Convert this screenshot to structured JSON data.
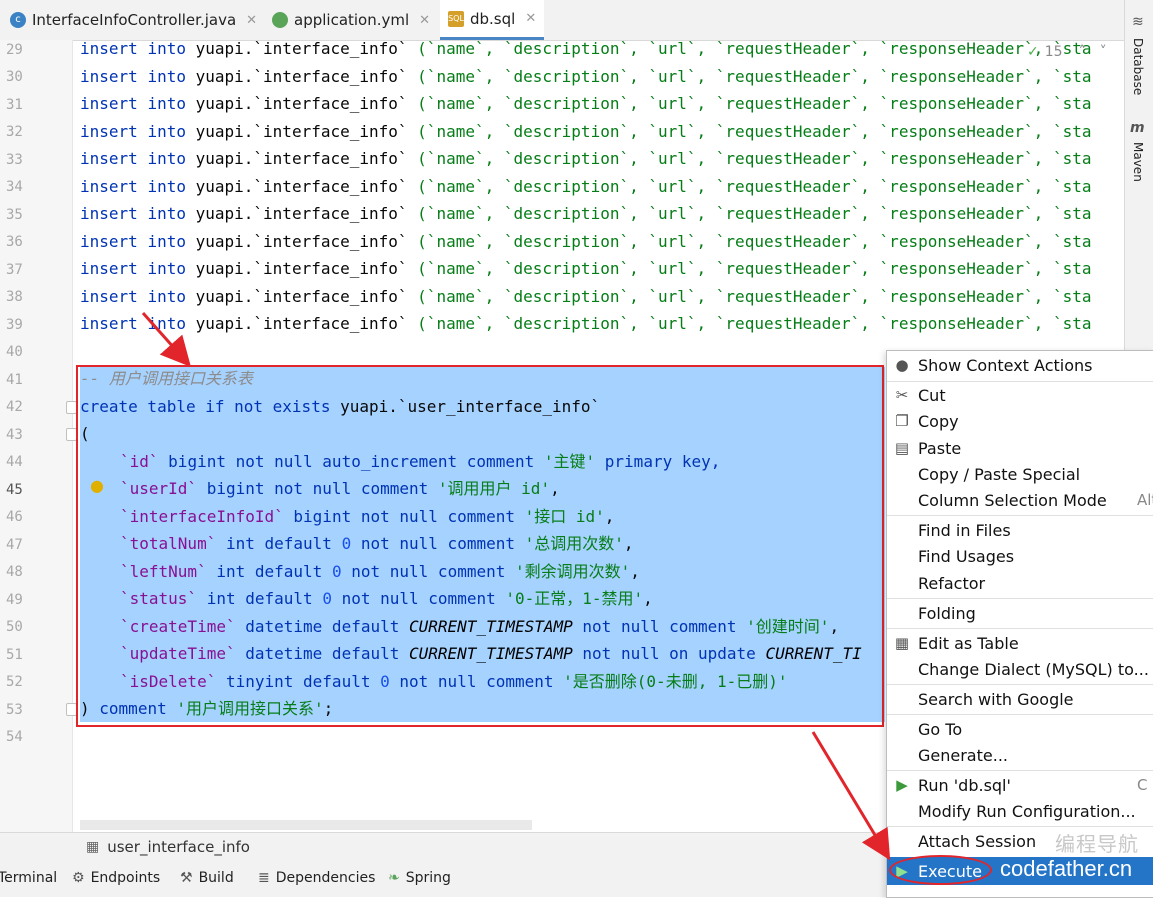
{
  "tabs": [
    {
      "label": "InterfaceInfoController.java",
      "icon": "java-class-icon",
      "color": "#3b82c4"
    },
    {
      "label": "application.yml",
      "icon": "spring-config-icon",
      "color": "#5aa45a"
    },
    {
      "label": "db.sql",
      "icon": "sql-file-icon",
      "color": "#d4a02a",
      "active": true
    }
  ],
  "right_tools": [
    "Database",
    "Maven"
  ],
  "inlay": {
    "count": "15"
  },
  "line_numbers": [
    "29",
    "30",
    "31",
    "32",
    "33",
    "34",
    "35",
    "36",
    "37",
    "38",
    "39",
    "40",
    "41",
    "42",
    "43",
    "44",
    "45",
    "46",
    "47",
    "48",
    "49",
    "50",
    "51",
    "52",
    "53",
    "54"
  ],
  "insert_line": {
    "kw_insert": "insert",
    "kw_into": "into",
    "table": "yuapi.`interface_info`",
    "cols_text": "(`name`, `description`, `url`, `requestHeader`, `responseHeader`, `sta"
  },
  "code": {
    "l41": "-- 用户调用接口关系表",
    "l42_kw": "create table if not exists",
    "l42_tbl": "yuapi.`user_interface_info`",
    "l43": "(",
    "l44_id": "`id`",
    "l44_kw": "bigint not null auto_increment comment",
    "l44_str": "'主键'",
    "l44_tail": "primary key,",
    "l45_id": "`userId`",
    "l45_kw": "bigint not null comment",
    "l45_str": "'调用用户 id'",
    "l46_id": "`interfaceInfoId`",
    "l46_kw": "bigint not null comment",
    "l46_str": "'接口 id'",
    "l47_id": "`totalNum`",
    "l47_kw1": "int default",
    "l47_num": "0",
    "l47_kw2": "not null comment",
    "l47_str": "'总调用次数'",
    "l48_id": "`leftNum`",
    "l48_kw1": "int default",
    "l48_num": "0",
    "l48_kw2": "not null comment",
    "l48_str": "'剩余调用次数'",
    "l49_id": "`status`",
    "l49_kw1": "int default",
    "l49_num": "0",
    "l49_kw2": "not null comment",
    "l49_str": "'0-正常，1-禁用'",
    "l50_id": "`createTime`",
    "l50_kw1": "datetime default",
    "l50_fn": "CURRENT_TIMESTAMP",
    "l50_kw2": "not null comment",
    "l50_str": "'创建时间'",
    "l51_id": "`updateTime`",
    "l51_kw1": "datetime default",
    "l51_fn": "CURRENT_TIMESTAMP",
    "l51_kw2": "not null on update",
    "l51_fn2": "CURRENT_TI",
    "l52_id": "`isDelete`",
    "l52_kw1": "tinyint default",
    "l52_num": "0",
    "l52_kw2": "not null comment",
    "l52_str": "'是否删除(0-未删, 1-已删)'",
    "l53_paren": ")",
    "l53_kw": "comment",
    "l53_str": "'用户调用接口关系'"
  },
  "breadcrumb": "user_interface_info",
  "bottom_tools": [
    "Terminal",
    "Endpoints",
    "Build",
    "Dependencies",
    "Spring"
  ],
  "context_menu": [
    {
      "label": "Show Context Actions",
      "icon": "lightbulb-icon"
    },
    {
      "label": "Cut",
      "icon": "scissors-icon"
    },
    {
      "label": "Copy",
      "icon": "copy-icon"
    },
    {
      "label": "Paste",
      "icon": "paste-icon"
    },
    {
      "label": "Copy / Paste Special"
    },
    {
      "label": "Column Selection Mode",
      "shortcut": "Alt"
    },
    {
      "label": "Find in Files"
    },
    {
      "label": "Find Usages"
    },
    {
      "label": "Refactor"
    },
    {
      "label": "Folding"
    },
    {
      "label": "Edit as Table",
      "icon": "table-icon"
    },
    {
      "label": "Change Dialect (MySQL) to..."
    },
    {
      "label": "Search with Google"
    },
    {
      "label": "Go To"
    },
    {
      "label": "Generate..."
    },
    {
      "label": "Run 'db.sql'",
      "icon": "run-icon",
      "shortcut": "C"
    },
    {
      "label": "Modify Run Configuration..."
    },
    {
      "label": "Attach Session"
    },
    {
      "label": "Execute",
      "icon": "run-icon"
    }
  ],
  "watermark": {
    "cn": "编程导航",
    "site": "codefather.cn"
  },
  "colors": {
    "accent": "#2475c8",
    "selection": "#a6d2ff",
    "annotation_red": "#e1252b"
  }
}
